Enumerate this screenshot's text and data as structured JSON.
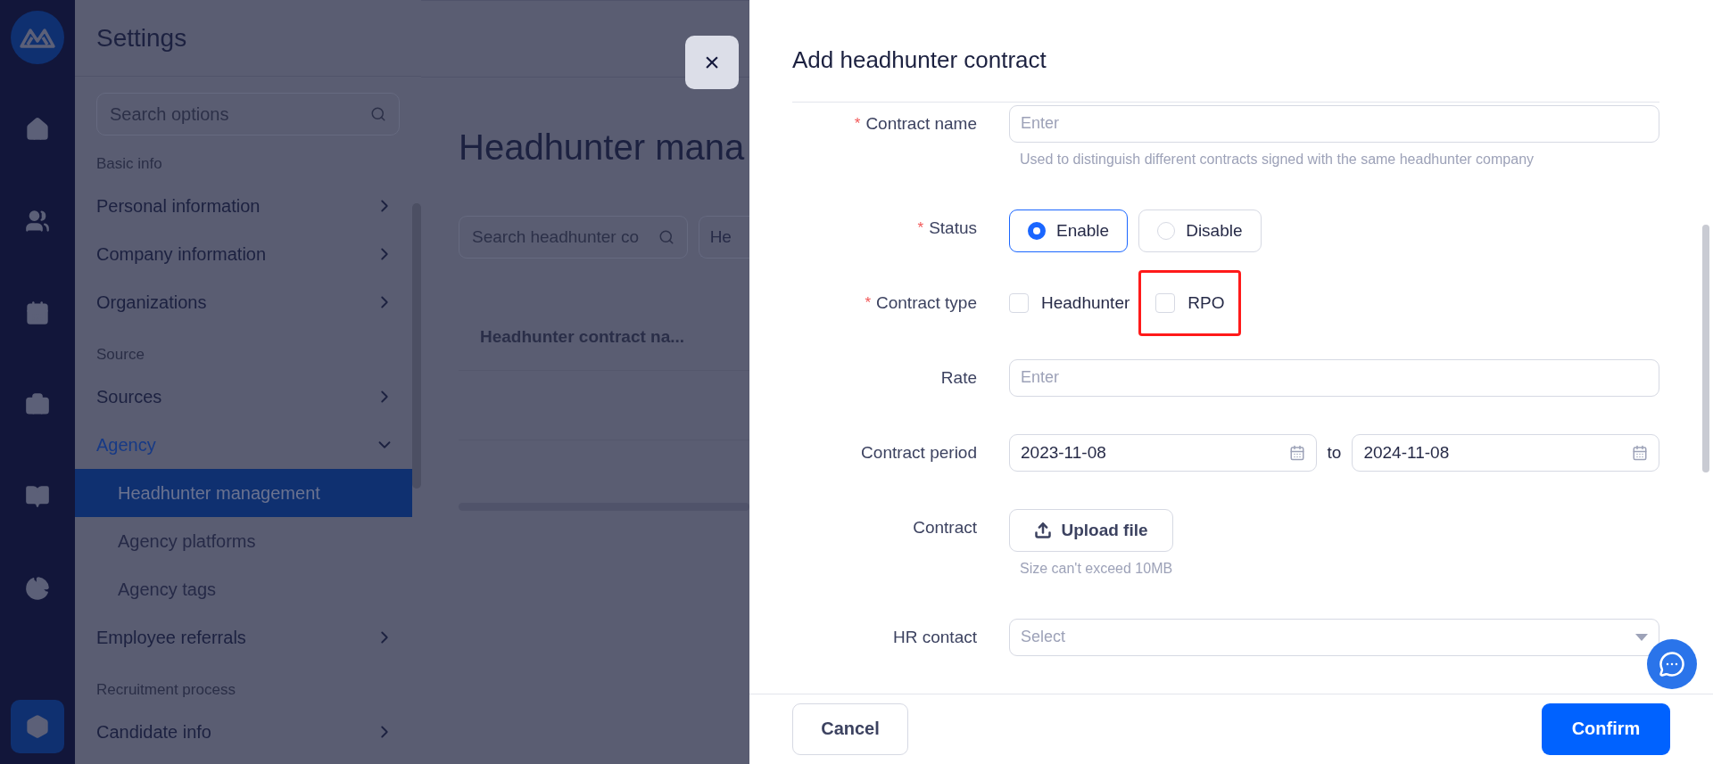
{
  "rail": {
    "items": [
      {
        "kind": "home",
        "selected": false
      },
      {
        "kind": "people",
        "selected": false
      },
      {
        "kind": "calendar",
        "selected": false
      },
      {
        "kind": "briefcase",
        "selected": false
      },
      {
        "kind": "cards",
        "selected": false
      },
      {
        "kind": "chart",
        "selected": false
      },
      {
        "kind": "settings",
        "selected": true
      }
    ]
  },
  "sidebar": {
    "title": "Settings",
    "search": {
      "placeholder": "Search options"
    },
    "sections": [
      {
        "title": "Basic info",
        "items": [
          {
            "label": "Personal information",
            "expanded": false
          },
          {
            "label": "Company information",
            "expanded": false
          },
          {
            "label": "Organizations",
            "expanded": false
          }
        ]
      },
      {
        "title": "Source",
        "items": [
          {
            "label": "Sources",
            "expanded": false
          },
          {
            "label": "Agency",
            "expanded": true,
            "children": [
              {
                "label": "Headhunter management",
                "selected": true
              },
              {
                "label": "Agency platforms",
                "selected": false
              },
              {
                "label": "Agency tags",
                "selected": false
              }
            ]
          },
          {
            "label": "Employee referrals",
            "expanded": false
          }
        ]
      },
      {
        "title": "Recruitment process",
        "items": [
          {
            "label": "Candidate info",
            "expanded": false
          }
        ]
      }
    ]
  },
  "main": {
    "title": "Headhunter mana",
    "search": {
      "placeholder": "Search headhunter co"
    },
    "filter": {
      "value": "He"
    },
    "table": {
      "columns": [
        "Headhunter contract na..."
      ]
    }
  },
  "drawer": {
    "close": "×",
    "title": "Add headhunter contract",
    "required_mark": "*",
    "fields": [
      {
        "kind": "text",
        "label": "Contract name",
        "required": true,
        "placeholder": "Enter",
        "hint": "Used to distinguish different contracts signed with the same headhunter company"
      },
      {
        "kind": "radio",
        "label": "Status",
        "required": true,
        "options": [
          {
            "label": "Enable",
            "selected": true
          },
          {
            "label": "Disable",
            "selected": false
          }
        ]
      },
      {
        "kind": "checkbox",
        "label": "Contract type",
        "required": true,
        "options": [
          {
            "label": "Headhunter",
            "checked": false,
            "highlighted": false
          },
          {
            "label": "RPO",
            "checked": false,
            "highlighted": true
          }
        ]
      },
      {
        "kind": "text",
        "label": "Rate",
        "required": false,
        "placeholder": "Enter"
      },
      {
        "kind": "daterange",
        "label": "Contract period",
        "required": false,
        "start": "2023-11-08",
        "separator": "to",
        "end": "2024-11-08"
      },
      {
        "kind": "upload",
        "label": "Contract",
        "required": false,
        "button": "Upload file",
        "hint": "Size can't exceed 10MB"
      },
      {
        "kind": "select",
        "label": "HR contact",
        "required": false,
        "placeholder": "Select"
      }
    ],
    "buttons": {
      "cancel": "Cancel",
      "confirm": "Confirm"
    }
  }
}
